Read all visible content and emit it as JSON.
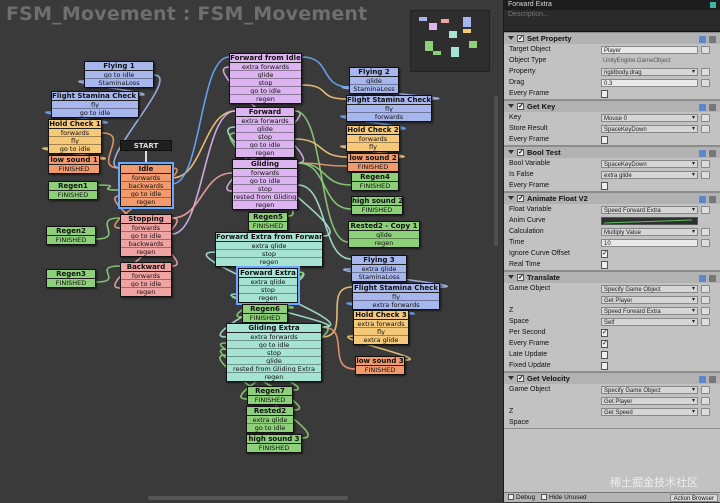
{
  "canvas": {
    "title": "FSM_Movement : FSM_Movement",
    "start_label": "START"
  },
  "states": [
    {
      "id": "flying1",
      "title": "Flying 1",
      "events": [
        "go to idle",
        "StaminaLoss"
      ],
      "color": "#a7b7ee"
    },
    {
      "id": "fsc1",
      "title": "Flight Stamina Check 1",
      "events": [
        "fly",
        "go to idle"
      ],
      "color": "#a7b7ee"
    },
    {
      "id": "hold1",
      "title": "Hold Check 1",
      "events": [
        "forwards",
        "fly",
        "go to idle"
      ],
      "color": "#f6c87a"
    },
    {
      "id": "low1",
      "title": "low sound 1",
      "events": [
        "FINISHED"
      ],
      "color": "#f19a6e"
    },
    {
      "id": "regen1",
      "title": "Regen1",
      "events": [
        "FINISHED"
      ],
      "color": "#8ecf7a"
    },
    {
      "id": "regen2",
      "title": "Regen2",
      "events": [
        "FINISHED"
      ],
      "color": "#8ecf7a"
    },
    {
      "id": "regen3",
      "title": "Regen3",
      "events": [
        "FINISHED"
      ],
      "color": "#8ecf7a"
    },
    {
      "id": "idle",
      "title": "Idle",
      "events": [
        "forwards",
        "backwards",
        "go to idle",
        "regen"
      ],
      "color": "#f19a6e"
    },
    {
      "id": "stopping",
      "title": "Stopping",
      "events": [
        "forwards",
        "go to idle",
        "backwards",
        "regen"
      ],
      "color": "#f0a3a3"
    },
    {
      "id": "backward",
      "title": "Backward",
      "events": [
        "forwards",
        "go to idle",
        "regen"
      ],
      "color": "#f0a3a3"
    },
    {
      "id": "ffi",
      "title": "Forward from Idle",
      "events": [
        "extra forwards",
        "glide",
        "stop",
        "go to idle",
        "regen"
      ],
      "color": "#dcb5f0"
    },
    {
      "id": "forward",
      "title": "Forward",
      "events": [
        "extra forwards",
        "glide",
        "stop",
        "go to idle",
        "regen"
      ],
      "color": "#dcb5f0"
    },
    {
      "id": "gliding",
      "title": "Gliding",
      "events": [
        "forwards",
        "go to idle",
        "stop",
        "rested from Gliding",
        "regen"
      ],
      "color": "#dcb5f0"
    },
    {
      "id": "regen5",
      "title": "Regen5",
      "events": [
        "FINISHED"
      ],
      "color": "#8ecf7a"
    },
    {
      "id": "fefe",
      "title": "Forward Extra from Forward",
      "events": [
        "extra glide",
        "stop",
        "regen"
      ],
      "color": "#a7e3d3"
    },
    {
      "id": "fe",
      "title": "Forward Extra",
      "events": [
        "extra glide",
        "stop",
        "regen"
      ],
      "color": "#a7e3d3"
    },
    {
      "id": "regen6",
      "title": "Regen6",
      "events": [
        "FINISHED"
      ],
      "color": "#8ecf7a"
    },
    {
      "id": "glidingextra",
      "title": "Gliding Extra",
      "events": [
        "extra forwards",
        "go to idle",
        "stop",
        "glide",
        "rested from Gliding Extra",
        "regen"
      ],
      "color": "#a7e3d3"
    },
    {
      "id": "regen7",
      "title": "Regen7",
      "events": [
        "FINISHED"
      ],
      "color": "#8ecf7a"
    },
    {
      "id": "rested2",
      "title": "Rested2",
      "events": [
        "extra glide",
        "go to idle"
      ],
      "color": "#8ecf7a"
    },
    {
      "id": "high3",
      "title": "high sound 3",
      "events": [
        "FINISHED"
      ],
      "color": "#8ecf7a"
    },
    {
      "id": "flying2",
      "title": "Flying 2",
      "events": [
        "glide",
        "StaminaLoss"
      ],
      "color": "#a7b7ee"
    },
    {
      "id": "fsc2",
      "title": "Flight Stamina Check 2",
      "events": [
        "fly",
        "forwards"
      ],
      "color": "#a7b7ee"
    },
    {
      "id": "hold2",
      "title": "Hold Check 2",
      "events": [
        "forwards",
        "fly"
      ],
      "color": "#f6c87a"
    },
    {
      "id": "low2",
      "title": "low sound 2",
      "events": [
        "FINISHED"
      ],
      "color": "#f19a6e"
    },
    {
      "id": "regen4",
      "title": "Regen4",
      "events": [
        "FINISHED"
      ],
      "color": "#8ecf7a"
    },
    {
      "id": "high2",
      "title": "high sound 2",
      "events": [
        "FINISHED"
      ],
      "color": "#8ecf7a"
    },
    {
      "id": "rested2copy",
      "title": "Rested2 - Copy 1",
      "events": [
        "glide",
        "regen"
      ],
      "color": "#8ecf7a"
    },
    {
      "id": "flying3",
      "title": "Flying 3",
      "events": [
        "extra glide",
        "StaminaLoss"
      ],
      "color": "#a7b7ee"
    },
    {
      "id": "fsc3",
      "title": "Flight Stamina Check",
      "events": [
        "fly",
        "extra forwards"
      ],
      "color": "#a7b7ee"
    },
    {
      "id": "hold3",
      "title": "Hold Check 3",
      "events": [
        "extra forwards",
        "fly",
        "extra glide"
      ],
      "color": "#f6c87a"
    },
    {
      "id": "low3",
      "title": "low sound 3",
      "events": [
        "FINISHED"
      ],
      "color": "#f19a6e"
    }
  ],
  "inspector": {
    "state_name": "Forward Extra",
    "description": "Description...",
    "actions": [
      {
        "title": "Set Property",
        "rows": [
          {
            "label": "Target Object",
            "value": "Player",
            "kind": "field"
          },
          {
            "label": "Object Type",
            "value": "UnityEngine.GameObject",
            "kind": "plain"
          },
          {
            "label": "Property",
            "value": "rigidbody.drag",
            "kind": "drop"
          },
          {
            "label": "Drag",
            "value": "0.3",
            "kind": "field"
          },
          {
            "label": "Every Frame",
            "value": "",
            "kind": "check"
          }
        ]
      },
      {
        "title": "Get Key",
        "rows": [
          {
            "label": "Key",
            "value": "Mouse 0",
            "kind": "drop"
          },
          {
            "label": "Store Result",
            "value": "SpaceKeyDown",
            "kind": "drop"
          },
          {
            "label": "Every Frame",
            "value": "",
            "kind": "check"
          }
        ]
      },
      {
        "title": "Bool Test",
        "rows": [
          {
            "label": "Bool Variable",
            "value": "SpaceKeyDown",
            "kind": "drop"
          },
          {
            "label": "Is False",
            "value": "extra glide",
            "kind": "drop"
          },
          {
            "label": "Every Frame",
            "value": "",
            "kind": "check"
          }
        ]
      },
      {
        "title": "Animate Float V2",
        "rows": [
          {
            "label": "Float Variable",
            "value": "Speed Forward Extra",
            "kind": "drop"
          },
          {
            "label": "Anim Curve",
            "value": "",
            "kind": "curve"
          },
          {
            "label": "Calculation",
            "value": "Multiply Value",
            "kind": "drop"
          },
          {
            "label": "Time",
            "value": "10",
            "kind": "field"
          },
          {
            "label": "Ignore Curve Offset",
            "value": "",
            "kind": "checkon"
          },
          {
            "label": "Real Time",
            "value": "",
            "kind": "check"
          }
        ]
      },
      {
        "title": "Translate",
        "rows": [
          {
            "label": "Game Object",
            "value": "Specify Game Object",
            "kind": "drop"
          },
          {
            "label": "",
            "value": "Get Player",
            "kind": "drop"
          },
          {
            "label": "Z",
            "value": "Speed Forward Extra",
            "kind": "drop"
          },
          {
            "label": "Space",
            "value": "Self",
            "kind": "drop"
          },
          {
            "label": "Per Second",
            "value": "",
            "kind": "checkon"
          },
          {
            "label": "Every Frame",
            "value": "",
            "kind": "checkon"
          },
          {
            "label": "Late Update",
            "value": "",
            "kind": "check"
          },
          {
            "label": "Fixed Update",
            "value": "",
            "kind": "check"
          }
        ]
      },
      {
        "title": "Get Velocity",
        "rows": [
          {
            "label": "Game Object",
            "value": "Specify Game Object",
            "kind": "drop"
          },
          {
            "label": "",
            "value": "Get Player",
            "kind": "drop"
          },
          {
            "label": "Z",
            "value": "Get Speed",
            "kind": "drop"
          },
          {
            "label": "Space",
            "value": "",
            "kind": "plain"
          }
        ]
      }
    ],
    "footer": {
      "debug": "Debug",
      "hide_unused": "Hide Unused",
      "action_browser": "Action Browser"
    }
  },
  "watermark": "稀土掘金技术社区"
}
